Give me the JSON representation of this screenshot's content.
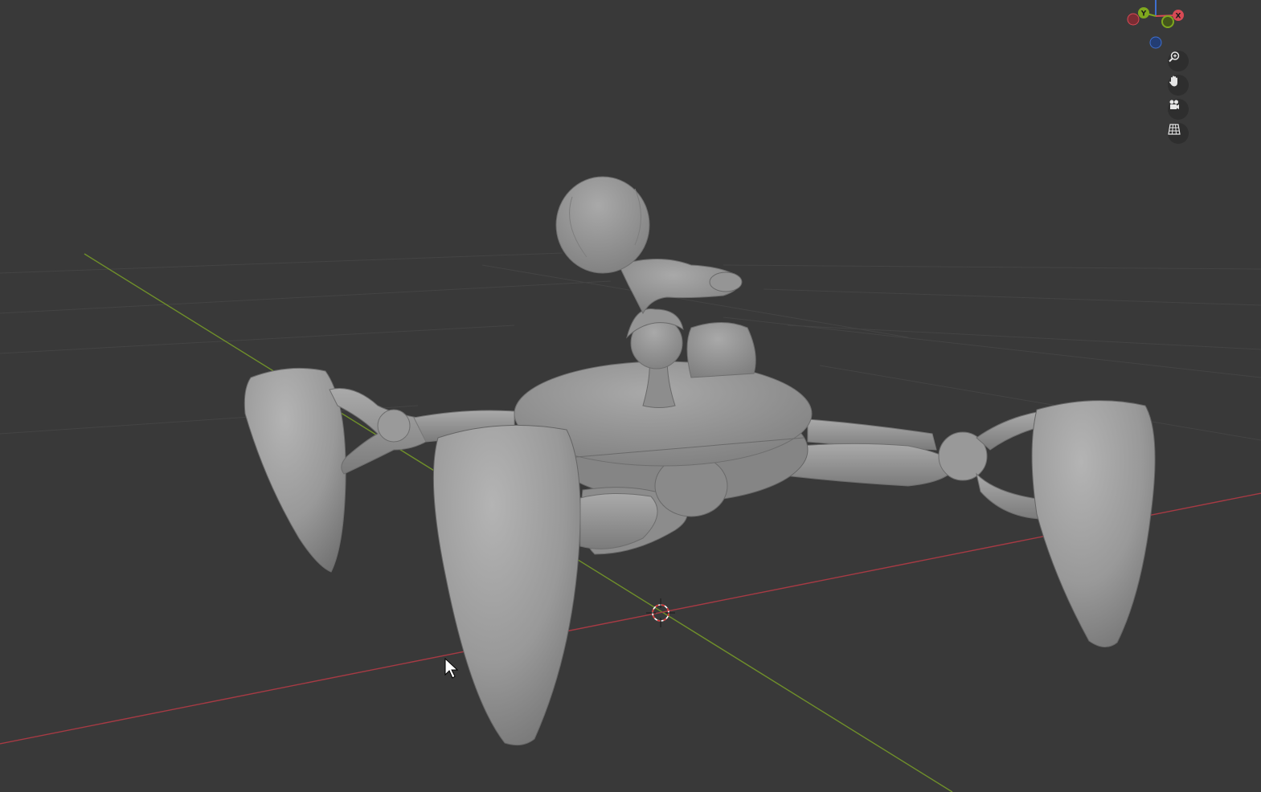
{
  "viewport": {
    "name": "3D Viewport",
    "background_color": "#393939",
    "grid_color": "#434343",
    "x_axis_color": "#a63a44",
    "y_axis_color": "#6f8f2a",
    "model_color": "#9c9c9c"
  },
  "gizmo": {
    "axes": [
      {
        "name": "X",
        "label": "X",
        "color": "#d84a55"
      },
      {
        "name": "Y",
        "label": "Y",
        "color": "#7fa81e"
      },
      {
        "name": "Z",
        "label": "",
        "color": "#3f6fcf"
      }
    ]
  },
  "nav_buttons": [
    {
      "name": "zoom-icon",
      "tool": "zoom"
    },
    {
      "name": "hand-icon",
      "tool": "pan"
    },
    {
      "name": "camera-icon",
      "tool": "camera"
    },
    {
      "name": "grid-icon",
      "tool": "orthographic"
    }
  ]
}
